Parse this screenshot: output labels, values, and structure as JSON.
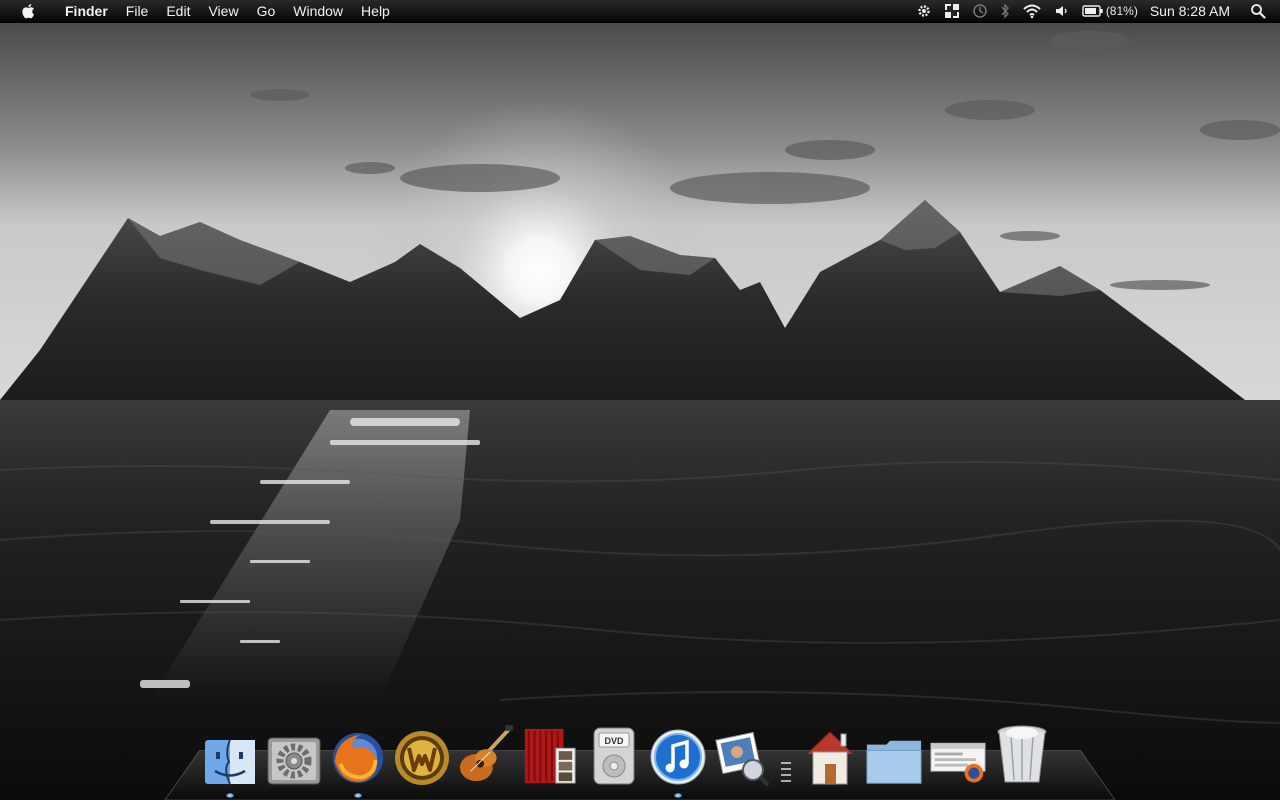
{
  "menubar": {
    "apple_icon": "apple-icon",
    "app_name": "Finder",
    "menus": [
      "File",
      "Edit",
      "View",
      "Go",
      "Window",
      "Help"
    ],
    "status_icons": [
      "gear-icon",
      "spaces-icon",
      "time-machine-icon",
      "bluetooth-icon",
      "wifi-icon",
      "volume-icon",
      "battery-icon"
    ],
    "battery_text": "(81%)",
    "clock": "Sun 8:28 AM",
    "spotlight_icon": "spotlight-icon"
  },
  "dock": {
    "apps": [
      {
        "name": "Finder",
        "icon": "finder-icon",
        "running": true
      },
      {
        "name": "System Preferences",
        "icon": "system-preferences-icon",
        "running": false
      },
      {
        "name": "Firefox",
        "icon": "firefox-icon",
        "running": true
      },
      {
        "name": "World of Warcraft",
        "icon": "warcraft-icon",
        "running": false
      },
      {
        "name": "GarageBand",
        "icon": "garageband-icon",
        "running": false
      },
      {
        "name": "Photo Booth",
        "icon": "photo-booth-icon",
        "running": false
      },
      {
        "name": "DVD Player",
        "icon": "dvd-player-icon",
        "running": false
      },
      {
        "name": "iTunes",
        "icon": "itunes-icon",
        "running": true
      },
      {
        "name": "Preview",
        "icon": "preview-icon",
        "running": false
      }
    ],
    "stacks": [
      {
        "name": "Home",
        "icon": "home-folder-icon"
      },
      {
        "name": "Folder",
        "icon": "folder-icon"
      },
      {
        "name": "Downloads",
        "icon": "firefox-download-icon"
      },
      {
        "name": "Trash",
        "icon": "trash-icon"
      }
    ]
  },
  "colors": {
    "menubar_bg": "#0a0a0a",
    "menubar_text": "#f2f2f2",
    "itunes_blue": "#1f6fd0",
    "firefox_orange": "#e8731a"
  }
}
